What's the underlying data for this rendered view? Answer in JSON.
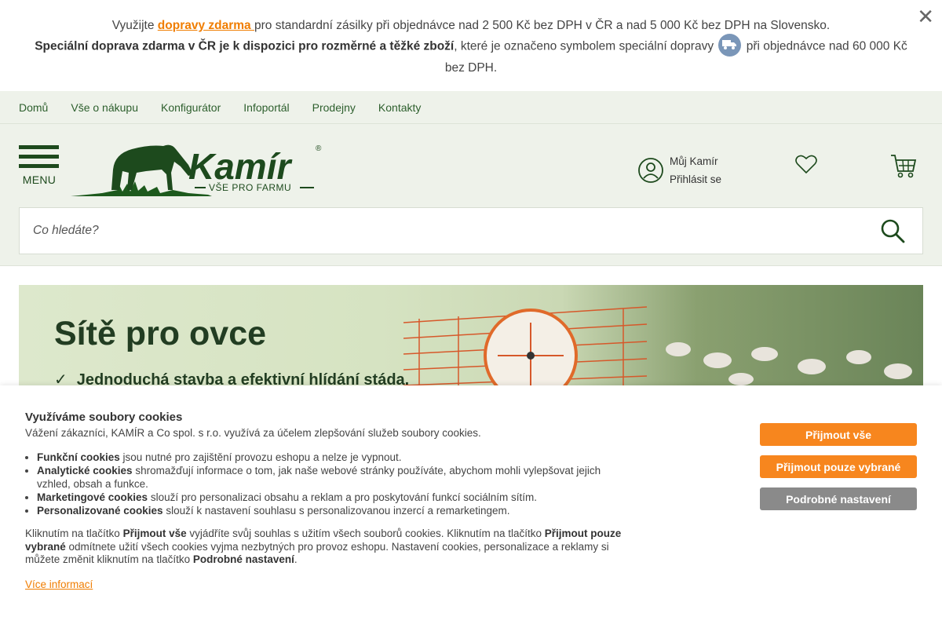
{
  "notice": {
    "line1_prefix": "Využijte ",
    "line1_link": "dopravy zdarma ",
    "line1_suffix": "pro standardní zásilky při objednávce nad 2 500 Kč bez DPH v ČR a nad 5 000 Kč bez DPH na Slovensko.",
    "line2_bold": "Speciální doprava zdarma v ČR je k dispozici pro rozměrné a těžké zboží",
    "line2_mid": ", které je označeno symbolem speciální dopravy ",
    "line2_end": " při objednávce nad 60 000 Kč bez DPH.",
    "close_label": "✕"
  },
  "subnav": {
    "items": [
      "Domů",
      "Vše o nákupu",
      "Konfigurátor",
      "Infoportál",
      "Prodejny",
      "Kontakty"
    ]
  },
  "header": {
    "menu_label": "MENU",
    "logo_text": "Kamír",
    "logo_tagline": "VŠE PRO FARMU",
    "account_title": "Můj Kamír",
    "account_login": "Přihlásit se"
  },
  "search": {
    "placeholder": "Co hledáte?"
  },
  "banner": {
    "title": "Sítě pro ovce",
    "check": "✓",
    "line": "Jednoduchá stavba a efektivní hlídání stáda."
  },
  "cookies": {
    "title": "Využíváme soubory cookies",
    "intro": "Vážení zákazníci, KAMÍR a Co spol. s r.o. využívá za účelem zlepšování služeb soubory cookies.",
    "items": [
      {
        "bold": "Funkční cookies",
        "text": " jsou nutné pro zajištění provozu eshopu a nelze je vypnout."
      },
      {
        "bold": "Analytické cookies",
        "text": " shromažďují informace o tom, jak naše webové stránky používáte, abychom mohli vylepšovat jejich vzhled, obsah a funkce."
      },
      {
        "bold": "Marketingové cookies",
        "text": " slouží pro personalizaci obsahu a reklam a pro poskytování funkcí sociálním sítím."
      },
      {
        "bold": "Personalizované cookies",
        "text": " slouží k nastavení souhlasu s personalizovanou inzercí a remarketingem."
      }
    ],
    "info_1": "Kliknutím na tlačítko ",
    "info_b1": "Přijmout vše",
    "info_2": " vyjádříte svůj souhlas s užitím všech souborů cookies. Kliknutím na tlačítko ",
    "info_b2": "Přijmout pouze vybrané",
    "info_3": " odmítnete užití všech cookies vyjma nezbytných pro provoz eshopu. Nastavení cookies, personalizace a reklamy si můžete změnit kliknutím na tlačítko ",
    "info_b3": "Podrobné nastavení",
    "info_4": ".",
    "more_link": "Více informací",
    "btn_accept_all": "Přijmout vše",
    "btn_accept_selected": "Přijmout pouze vybrané",
    "btn_settings": "Podrobné nastavení"
  },
  "colors": {
    "accent": "#f7861e",
    "brand_green": "#1d4a1d",
    "header_bg": "#eef2ea"
  }
}
